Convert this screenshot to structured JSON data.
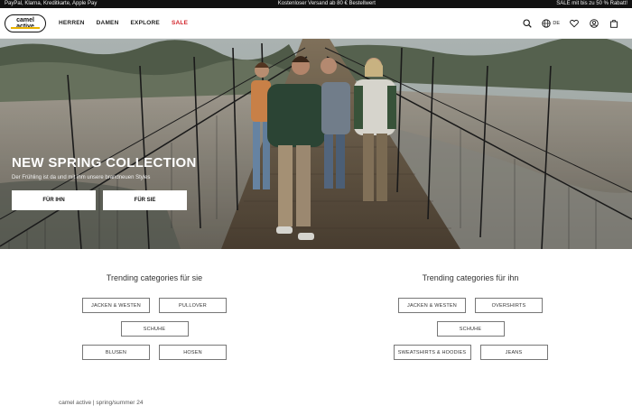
{
  "topbar": {
    "left": "PayPal, Klarna, Kreditkarte, Apple Pay",
    "center": "Kostenloser Versand ab 80 € Bestellwert",
    "right": "SALE mit bis zu 50 % Rabatt!"
  },
  "header": {
    "logo_line1": "camel",
    "logo_line2": "active",
    "nav": [
      {
        "label": "HERREN"
      },
      {
        "label": "DAMEN"
      },
      {
        "label": "EXPLORE"
      },
      {
        "label": "SALE"
      }
    ],
    "language": "DE"
  },
  "hero": {
    "title": "NEW SPRING COLLECTION",
    "subtitle": "Der Frühling ist da und mit ihm unsere brandneuen Styles",
    "button_ihn": "FÜR IHN",
    "button_sie": "FÜR SIE"
  },
  "trending_sie": {
    "title": "Trending categories für sie",
    "row1": [
      "JACKEN & WESTEN",
      "PULLOVER"
    ],
    "row2": [
      "SCHUHE"
    ],
    "row3": [
      "BLUSEN",
      "HOSEN"
    ]
  },
  "trending_ihn": {
    "title": "Trending categories für ihn",
    "row1": [
      "JACKEN & WESTEN",
      "OVERSHIRTS"
    ],
    "row2": [
      "SCHUHE"
    ],
    "row3": [
      "SWEATSHIRTS & HOODIES",
      "JEANS"
    ]
  },
  "footer": {
    "note": "camel active | spring/summer 24"
  },
  "colors": {
    "sale": "#d2232a",
    "logo_accent": "#e9b200"
  }
}
